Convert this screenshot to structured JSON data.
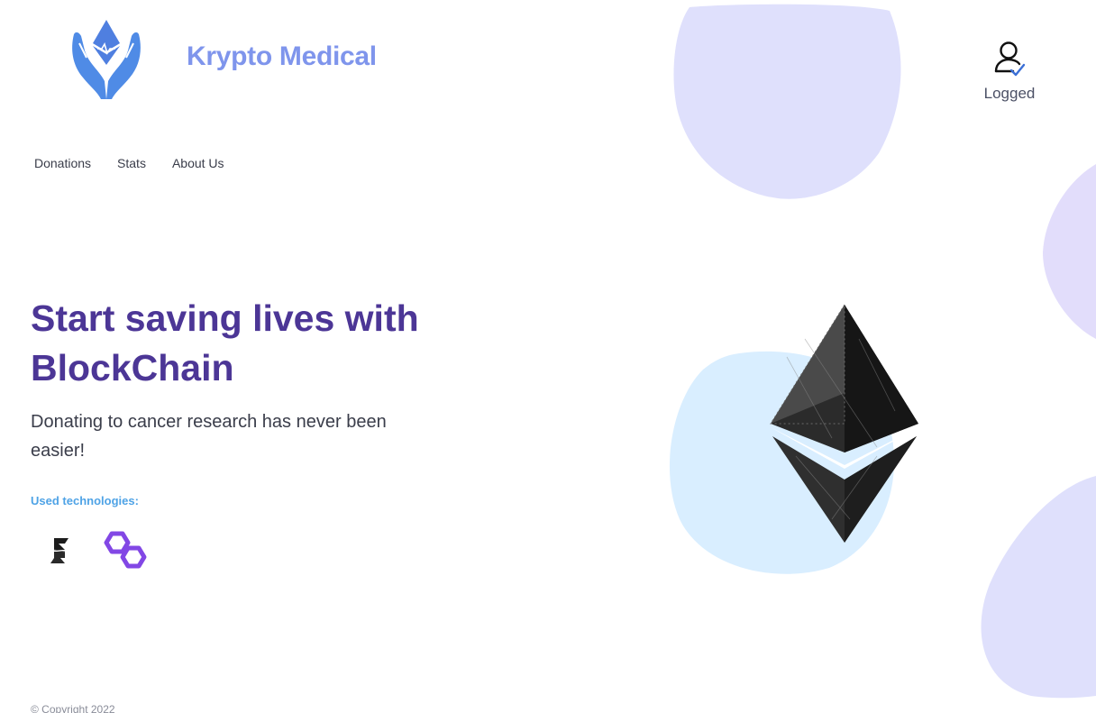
{
  "brand": {
    "name": "Krypto Medical"
  },
  "nav": {
    "items": [
      "Donations",
      "Stats",
      "About Us"
    ]
  },
  "user": {
    "status": "Logged"
  },
  "hero": {
    "title_line1": "Start saving lives with",
    "title_line2": "BlockChain",
    "subtitle": "Donating to cancer research has never been easier!",
    "tech_label": "Used technologies:"
  },
  "technologies": [
    "solana-icon",
    "polygon-icon"
  ],
  "footer": {
    "copyright": "© Copyright 2022"
  },
  "colors": {
    "brand": "#7f95ec",
    "heading": "#4c3696",
    "tech_label": "#4fa3e6",
    "blob_lavender": "#dfe0fc",
    "blob_blue": "#d9eeff",
    "polygon": "#8247e5"
  }
}
